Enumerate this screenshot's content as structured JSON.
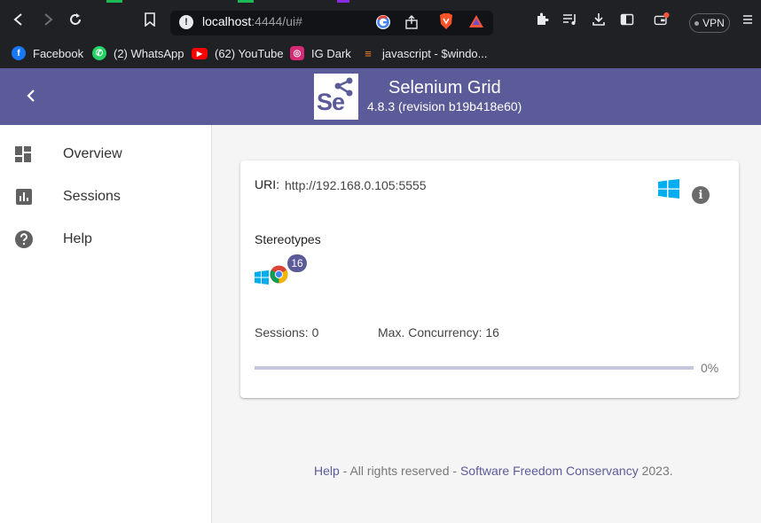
{
  "browser": {
    "url_host": "localhost",
    "url_rest": ":4444/ui#",
    "vpn_label": "VPN",
    "bookmarks": [
      {
        "label": "Facebook",
        "icon": "facebook-icon",
        "color": "#1877f2"
      },
      {
        "label": "(2) WhatsApp",
        "icon": "whatsapp-icon",
        "color": "#25d366"
      },
      {
        "label": "(62) YouTube",
        "icon": "youtube-icon",
        "color": "#ff0000"
      },
      {
        "label": "IG Dark",
        "icon": "instagram-icon",
        "color": "#d62976"
      },
      {
        "label": "javascript - $windo...",
        "icon": "stackoverflow-icon",
        "color": "#f48024"
      }
    ]
  },
  "header": {
    "logo_text": "Se",
    "title": "Selenium Grid",
    "version": "4.8.3 (revision b19b418e60)",
    "color": "#5b5b99"
  },
  "sidebar": {
    "items": [
      {
        "label": "Overview",
        "icon": "dashboard-icon"
      },
      {
        "label": "Sessions",
        "icon": "assessment-icon"
      },
      {
        "label": "Help",
        "icon": "help-icon"
      }
    ]
  },
  "node": {
    "uri_label": "URI:",
    "uri": "http://192.168.0.105:5555",
    "os_icon": "windows-icon",
    "stereotypes_label": "Stereotypes",
    "browser_icon": "chrome-icon",
    "slot_count": "16",
    "sessions": "Sessions: 0",
    "max_concurrency": "Max. Concurrency: 16",
    "progress_fraction": 0,
    "progress_label": "0%"
  },
  "footer": {
    "help": "Help",
    "middle": " - All rights reserved - ",
    "org": "Software Freedom Conservancy",
    "year": " 2023."
  }
}
